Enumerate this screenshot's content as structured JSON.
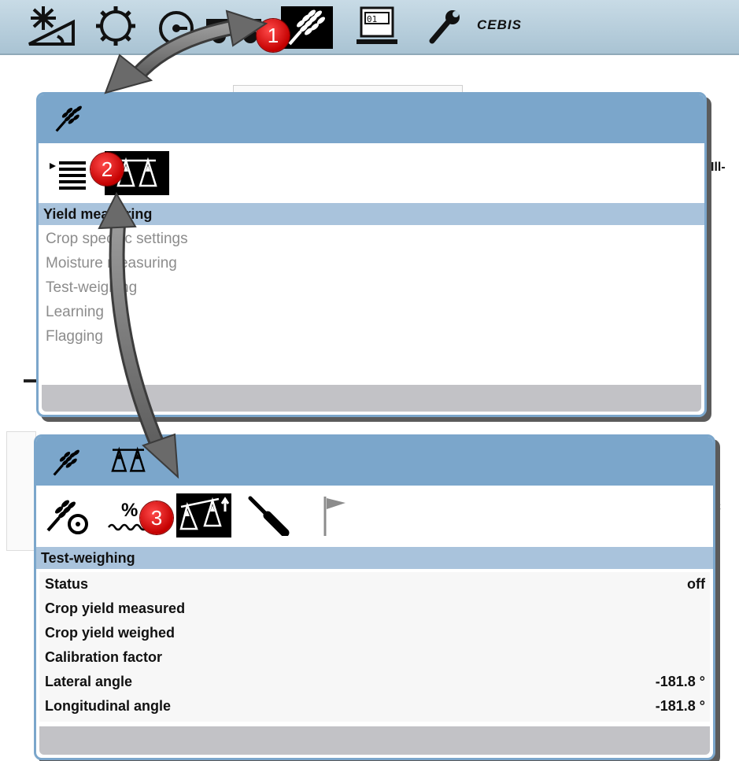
{
  "toolbar": {
    "icons": [
      "sun-angle-icon",
      "gear-icon",
      "gauge-icon",
      "crop-icon",
      "terminal-icon",
      "wrench-icon"
    ],
    "brand": "CEBIS",
    "badge": "1"
  },
  "panel1": {
    "header_icon": "crop-icon",
    "badge": "2",
    "selected": "Yield measuring",
    "items": [
      "Crop specific settings",
      "Moisture measuring",
      "Test-weighing",
      "Learning",
      "Flagging"
    ]
  },
  "panel2": {
    "header_icons": [
      "crop-icon",
      "scale-icon"
    ],
    "tab_icons": [
      "crop-gauge-icon",
      "moisture-icon",
      "test-weighing-icon",
      "screwdriver-icon",
      "flag-icon"
    ],
    "badge": "3",
    "selected": "Test-weighing",
    "rows": [
      {
        "label": "Status",
        "value": "off"
      },
      {
        "label": "Crop yield measured",
        "value": ""
      },
      {
        "label": "Crop yield weighed",
        "value": ""
      },
      {
        "label": "Calibration factor",
        "value": ""
      },
      {
        "label": "Lateral angle",
        "value": "-181.8 °"
      },
      {
        "label": "Longitudinal angle",
        "value": "-181.8 °"
      }
    ]
  },
  "colors": {
    "panel_blue": "#7ba6cb",
    "selection_blue": "#a9c3dc",
    "badge_red": "#d01010",
    "footer_gray": "#c2c2c6"
  }
}
